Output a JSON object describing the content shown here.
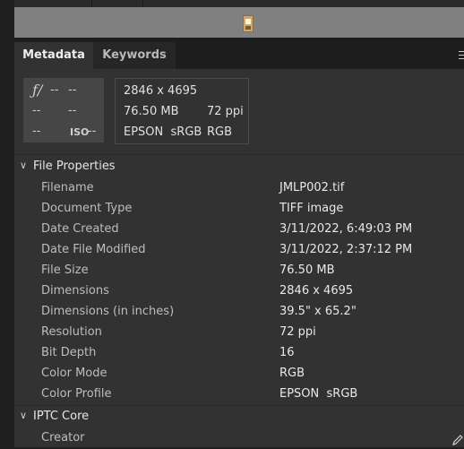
{
  "tabs": {
    "metadata": "Metadata",
    "keywords": "Keywords"
  },
  "camera": {
    "aperture_symbol": "ƒ/",
    "aperture": "--",
    "shutter": "--",
    "exposure_comp": "--",
    "flash": "--",
    "metering": "--",
    "iso_label": "ISO",
    "iso": "--"
  },
  "image_summary": {
    "dimensions": "2846 x 4695",
    "size": "76.50 MB",
    "resolution": "72 ppi",
    "profile": "EPSON  sRGB",
    "mode": "RGB"
  },
  "file_properties": {
    "title": "File Properties",
    "rows": [
      {
        "label": "Filename",
        "value": "JMLP002.tif"
      },
      {
        "label": "Document Type",
        "value": "TIFF image"
      },
      {
        "label": "Date Created",
        "value": "3/11/2022, 6:49:03 PM"
      },
      {
        "label": "Date File Modified",
        "value": "3/11/2022, 2:37:12 PM"
      },
      {
        "label": "File Size",
        "value": "76.50 MB"
      },
      {
        "label": "Dimensions",
        "value": "2846 x 4695"
      },
      {
        "label": "Dimensions (in inches)",
        "value": "39.5\" x 65.2\""
      },
      {
        "label": "Resolution",
        "value": "72 ppi"
      },
      {
        "label": "Bit Depth",
        "value": "16"
      },
      {
        "label": "Color Mode",
        "value": "RGB"
      },
      {
        "label": "Color Profile",
        "value": "EPSON  sRGB"
      }
    ]
  },
  "iptc_core": {
    "title": "IPTC Core",
    "rows": [
      {
        "label": "Creator",
        "value": ""
      }
    ]
  },
  "icons": {
    "section_toggle": "chevron-down-icon",
    "panel_menu": "menu-icon",
    "edit": "pencil-icon"
  }
}
